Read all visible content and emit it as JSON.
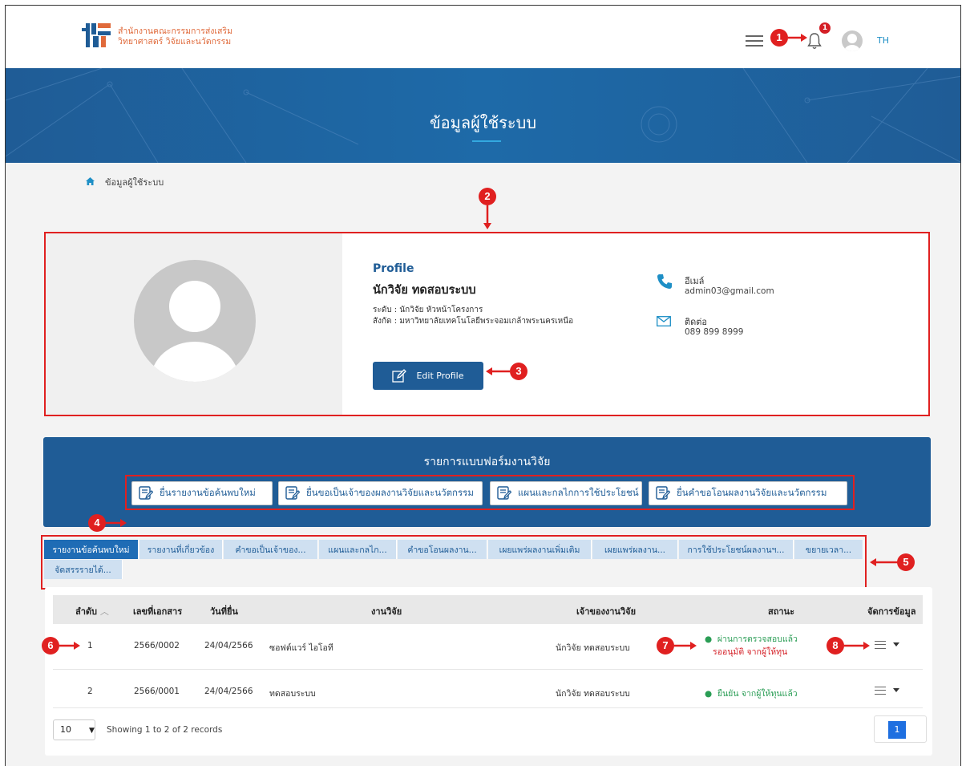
{
  "header": {
    "org_line1": "สำนักงานคณะกรรมการส่งเสริม",
    "org_line2": "วิทยาศาสตร์ วิจัยและนวัตกรรม",
    "notification_count": "1",
    "language": "TH"
  },
  "hero": {
    "title": "ข้อมูลผู้ใช้ระบบ"
  },
  "breadcrumb": {
    "current": "ข้อมูลผู้ใช้ระบบ"
  },
  "profile": {
    "section_label": "Profile",
    "name": "นักวิจัย ทดสอบระบบ",
    "level": "ระดับ  :  นักวิจัย หัวหน้าโครงการ",
    "affiliation": "สังกัด  :  มหาวิทยาลัยเทคโนโลยีพระจอมเกล้าพระนครเหนือ",
    "edit_button": "Edit Profile",
    "email_label": "อีเมล์",
    "email": "admin03@gmail.com",
    "contact_label": "ติดต่อ",
    "phone": "089 899 8999"
  },
  "forms": {
    "title": "รายการแบบฟอร์มงานวิจัย",
    "buttons": [
      "ยื่นรายงานข้อค้นพบใหม่",
      "ยื่นขอเป็นเจ้าของผลงานวิจัยและนวัตกรรม",
      "แผนและกลไกการใช้ประโยชน์",
      "ยื่นคำขอโอนผลงานวิจัยและนวัตกรรม"
    ]
  },
  "tabs": [
    "รายงานข้อค้นพบใหม่",
    "รายงานที่เกี่ยวข้อง",
    "คำขอเป็นเจ้าของ...",
    "แผนและกลไก...",
    "คำขอโอนผลงาน...",
    "เผยแพร่ผลงานเพิ่มเติม",
    "เผยแพร่ผลงาน...",
    "การใช้ประโยชน์ผลงานฯ...",
    "ขยายเวลา...",
    "จัดสรรรายได้..."
  ],
  "table": {
    "columns": [
      "ลำดับ",
      "เลขที่เอกสาร",
      "วันที่ยื่น",
      "งานวิจัย",
      "เจ้าของงานวิจัย",
      "สถานะ",
      "จัดการข้อมูล"
    ],
    "sort_indicator": "︿",
    "rows": [
      {
        "no": "1",
        "doc": "2566/0002",
        "date": "24/04/2566",
        "research": "ซอฟต์แวร์ ไอโอที",
        "owner": "นักวิจัย ทดสอบระบบ",
        "status_line1": "ผ่านการตรวจสอบแล้ว",
        "status_line2": "รออนุมัติ จากผู้ให้ทุน"
      },
      {
        "no": "2",
        "doc": "2566/0001",
        "date": "24/04/2566",
        "research": "ทดสอบระบบ",
        "owner": "นักวิจัย ทดสอบระบบ",
        "status_line1": "ยืนยัน จากผู้ให้ทุนแล้ว"
      }
    ],
    "page_size": "10",
    "records_text": "Showing 1 to 2 of 2 records",
    "current_page": "1"
  },
  "annotations": [
    "1",
    "2",
    "3",
    "4",
    "5",
    "6",
    "7",
    "8"
  ],
  "colors": {
    "primary": "#1f5c96",
    "annotation": "#e02020",
    "status_ok": "#2a9d55",
    "status_wait": "#d41f26"
  }
}
